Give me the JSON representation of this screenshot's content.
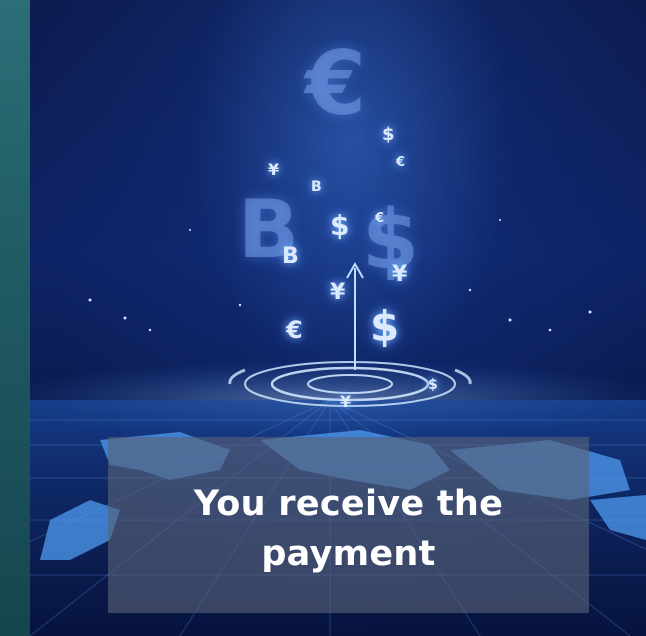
{
  "caption": {
    "text": "You receive the payment"
  },
  "symbols": {
    "euro": "€",
    "dollar": "$",
    "yen": "¥",
    "bitcoin": "B"
  },
  "colors": {
    "strip": "#2b6e77",
    "background": "#0d1b4f",
    "glow": "#dceaff",
    "caption_box": "#586278"
  }
}
